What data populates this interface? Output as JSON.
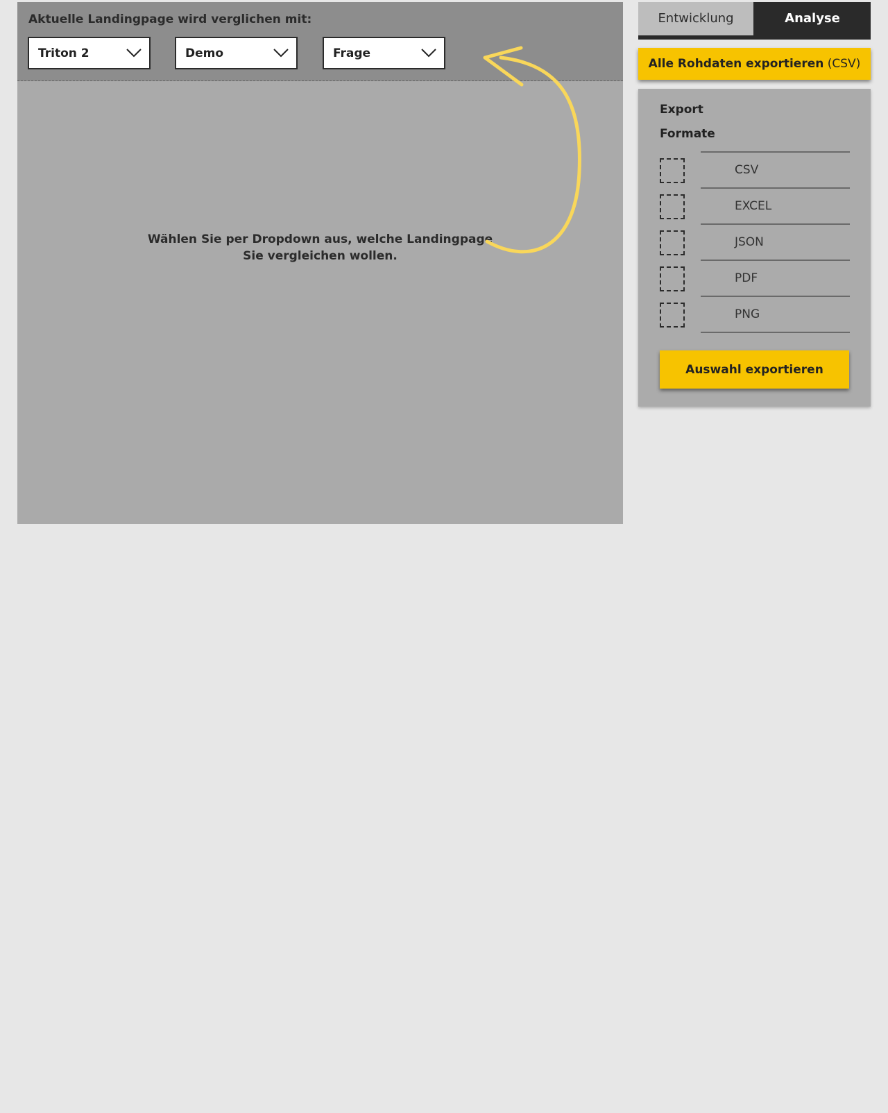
{
  "compare": {
    "label": "Aktuelle Landingpage wird verglichen mit:",
    "dropdowns": [
      "Triton 2",
      "Demo",
      "Frage"
    ]
  },
  "hint": {
    "line1": "Wählen Sie per Dropdown aus, welche Landingpage",
    "line2": "Sie vergleichen wollen."
  },
  "tabs": {
    "inactive": "Entwicklung",
    "active": "Analyse"
  },
  "export_all": {
    "bold": "Alle Rohdaten exportieren",
    "suffix": "(CSV)"
  },
  "export_card": {
    "title": "Export",
    "subtitle": "Formate",
    "formats": [
      "CSV",
      "EXCEL",
      "JSON",
      "PDF",
      "PNG"
    ],
    "button": "Auswahl exportieren"
  },
  "colors": {
    "accent": "#f7c300",
    "arrow": "#f9d75a",
    "tab_active_bg": "#2a2a2a"
  },
  "icons": {
    "dropdown": "chevron-down-icon",
    "annotation": "curved-arrow-icon"
  }
}
